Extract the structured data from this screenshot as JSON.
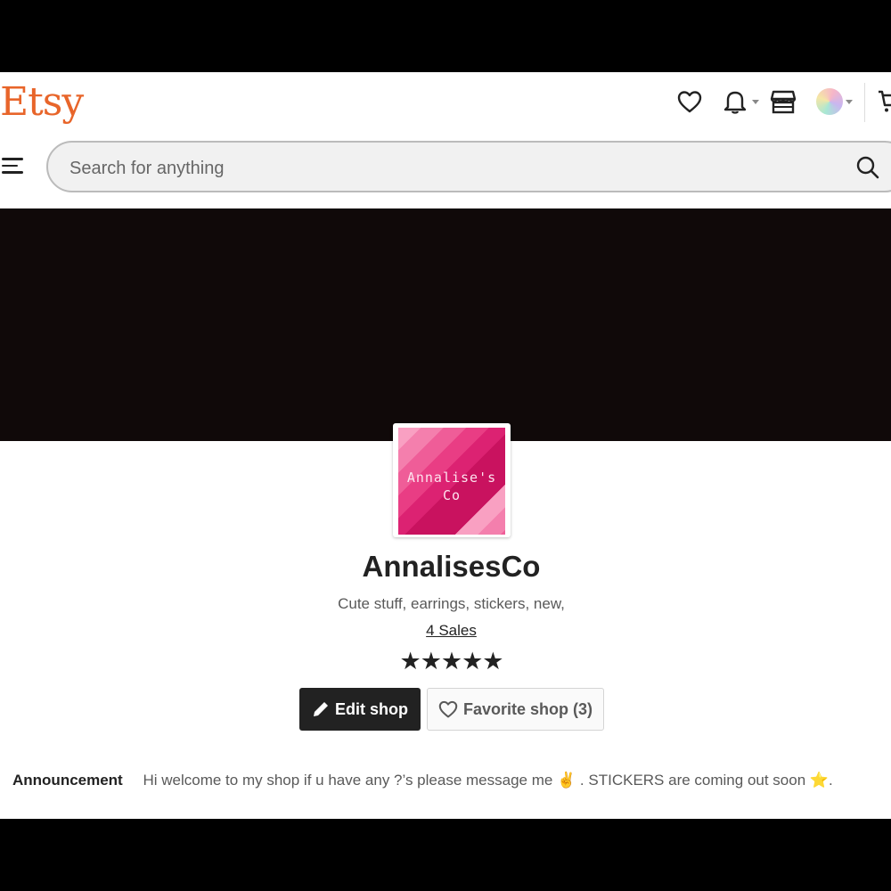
{
  "header": {
    "logo": "Etsy",
    "icons": [
      "heart-icon",
      "bell-icon",
      "shop-manager-icon",
      "avatar",
      "cart-icon"
    ]
  },
  "search": {
    "placeholder": "Search for anything"
  },
  "shop": {
    "logo_text_line1": "Annalise's",
    "logo_text_line2": "Co",
    "name": "AnnalisesCo",
    "tagline": "Cute stuff, earrings, stickers, new,",
    "sales": "4 Sales",
    "rating": 5,
    "stars": "★★★★★"
  },
  "actions": {
    "edit_label": "Edit shop",
    "favorite_label": "Favorite shop (3)"
  },
  "announcement": {
    "label": "Announcement",
    "text": "Hi welcome to my shop if u have any ?’s please message me ✌️ . STICKERS are coming out soon ⭐."
  },
  "colors": {
    "brand": "#e8652a",
    "banner": "#100909",
    "button_dark": "#222222",
    "logo_pink": "#e93d84"
  }
}
